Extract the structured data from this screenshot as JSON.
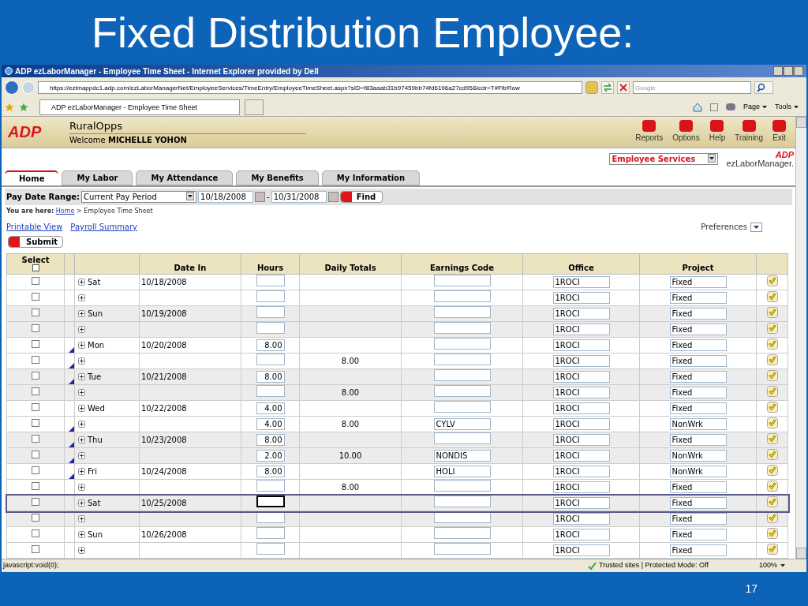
{
  "slide": {
    "title": "Fixed Distribution Employee:",
    "page_number": "17"
  },
  "window": {
    "title": "ADP ezLaborManager - Employee Time Sheet - Internet Explorer provided by Dell"
  },
  "address_bar": {
    "url": "https://ezlmappdc1.adp.com/ezLaborManagerNet/EmployeeServices/TimeEntry/EmployeeTimeSheet.aspx?sID=f83aaab31b97459bb74fd6196a27cd95&icdr=T#FltrRow",
    "search_placeholder": "Google"
  },
  "browser_tab": {
    "title": "ADP ezLaborManager - Employee Time Sheet"
  },
  "command_bar": [
    "Page",
    "Tools"
  ],
  "header": {
    "logo": "ADP",
    "company": "RuralOpps",
    "welcome": "Welcome",
    "user": "MICHELLE YOHON",
    "actions": [
      "Reports",
      "Options",
      "Help",
      "Training",
      "Exit"
    ]
  },
  "services": {
    "value": "Employee Services",
    "brand_logo": "ADP",
    "brand": "ezLaborManager."
  },
  "tabs": [
    {
      "label": "Home",
      "selected": true
    },
    {
      "label": "My Labor",
      "selected": false
    },
    {
      "label": "My Attendance",
      "selected": false
    },
    {
      "label": "My Benefits",
      "selected": false
    },
    {
      "label": "My Information",
      "selected": false
    }
  ],
  "filter": {
    "label": "Pay Date Range:",
    "range": "Current Pay Period",
    "from": "10/18/2008",
    "separator": "-",
    "to": "10/31/2008",
    "button": "Find"
  },
  "breadcrumb": {
    "label": "You are here:",
    "home": "Home",
    "current": "> Employee Time Sheet"
  },
  "links": [
    "Printable View",
    "Payroll Summary"
  ],
  "preferences": "Preferences",
  "submit": "Submit",
  "table": {
    "select_all_checked": false,
    "columns": [
      "Select",
      "Date In",
      "Hours",
      "Daily Totals",
      "Earnings Code",
      "Office",
      "Project"
    ],
    "rows": [
      {
        "day": "Sat",
        "date": "10/18/2008",
        "hours": "",
        "total": "",
        "code": "",
        "office": "1ROCI",
        "project": "Fixed",
        "checked": false,
        "comment_mark": false,
        "selected": false
      },
      {
        "day": "",
        "date": "",
        "hours": "",
        "total": "",
        "code": "",
        "office": "1ROCI",
        "project": "Fixed",
        "checked": false,
        "comment_mark": false,
        "selected": false
      },
      {
        "day": "Sun",
        "date": "10/19/2008",
        "hours": "",
        "total": "",
        "code": "",
        "office": "1ROCI",
        "project": "Fixed",
        "checked": false,
        "comment_mark": false,
        "selected": false
      },
      {
        "day": "",
        "date": "",
        "hours": "",
        "total": "",
        "code": "",
        "office": "1ROCI",
        "project": "Fixed",
        "checked": false,
        "comment_mark": false,
        "selected": false
      },
      {
        "day": "Mon",
        "date": "10/20/2008",
        "hours": "8.00",
        "total": "",
        "code": "",
        "office": "1ROCI",
        "project": "Fixed",
        "checked": false,
        "comment_mark": true,
        "selected": false
      },
      {
        "day": "",
        "date": "",
        "hours": "",
        "total": "8.00",
        "code": "",
        "office": "1ROCI",
        "project": "Fixed",
        "checked": false,
        "comment_mark": true,
        "selected": false
      },
      {
        "day": "Tue",
        "date": "10/21/2008",
        "hours": "8.00",
        "total": "",
        "code": "",
        "office": "1ROCI",
        "project": "Fixed",
        "checked": false,
        "comment_mark": true,
        "selected": false
      },
      {
        "day": "",
        "date": "",
        "hours": "",
        "total": "8.00",
        "code": "",
        "office": "1ROCI",
        "project": "Fixed",
        "checked": false,
        "comment_mark": false,
        "selected": false
      },
      {
        "day": "Wed",
        "date": "10/22/2008",
        "hours": "4.00",
        "total": "",
        "code": "",
        "office": "1ROCI",
        "project": "Fixed",
        "checked": false,
        "comment_mark": false,
        "selected": false
      },
      {
        "day": "",
        "date": "",
        "hours": "4.00",
        "total": "8.00",
        "code": "CYLV",
        "office": "1ROCI",
        "project": "NonWrk",
        "checked": false,
        "comment_mark": true,
        "selected": false
      },
      {
        "day": "Thu",
        "date": "10/23/2008",
        "hours": "8.00",
        "total": "",
        "code": "",
        "office": "1ROCI",
        "project": "Fixed",
        "checked": false,
        "comment_mark": true,
        "selected": false
      },
      {
        "day": "",
        "date": "",
        "hours": "2.00",
        "total": "10.00",
        "code": "NONDIS",
        "office": "1ROCI",
        "project": "NonWrk",
        "checked": false,
        "comment_mark": true,
        "selected": false
      },
      {
        "day": "Fri",
        "date": "10/24/2008",
        "hours": "8.00",
        "total": "",
        "code": "HOLI",
        "office": "1ROCI",
        "project": "NonWrk",
        "checked": false,
        "comment_mark": true,
        "selected": false
      },
      {
        "day": "",
        "date": "",
        "hours": "",
        "total": "8.00",
        "code": "",
        "office": "1ROCI",
        "project": "Fixed",
        "checked": false,
        "comment_mark": false,
        "selected": false
      },
      {
        "day": "Sat",
        "date": "10/25/2008",
        "hours": "",
        "total": "",
        "code": "",
        "office": "1ROCI",
        "project": "Fixed",
        "checked": false,
        "comment_mark": false,
        "selected": true
      },
      {
        "day": "",
        "date": "",
        "hours": "",
        "total": "",
        "code": "",
        "office": "1ROCI",
        "project": "Fixed",
        "checked": false,
        "comment_mark": false,
        "selected": false
      },
      {
        "day": "Sun",
        "date": "10/26/2008",
        "hours": "",
        "total": "",
        "code": "",
        "office": "1ROCI",
        "project": "Fixed",
        "checked": false,
        "comment_mark": false,
        "selected": false
      },
      {
        "day": "",
        "date": "",
        "hours": "",
        "total": "",
        "code": "",
        "office": "1ROCI",
        "project": "Fixed",
        "checked": false,
        "comment_mark": false,
        "selected": false
      }
    ]
  },
  "status_bar": {
    "text": "javascript:void(0);",
    "zone": "Trusted sites | Protected Mode: Off",
    "zoom": "100%"
  }
}
